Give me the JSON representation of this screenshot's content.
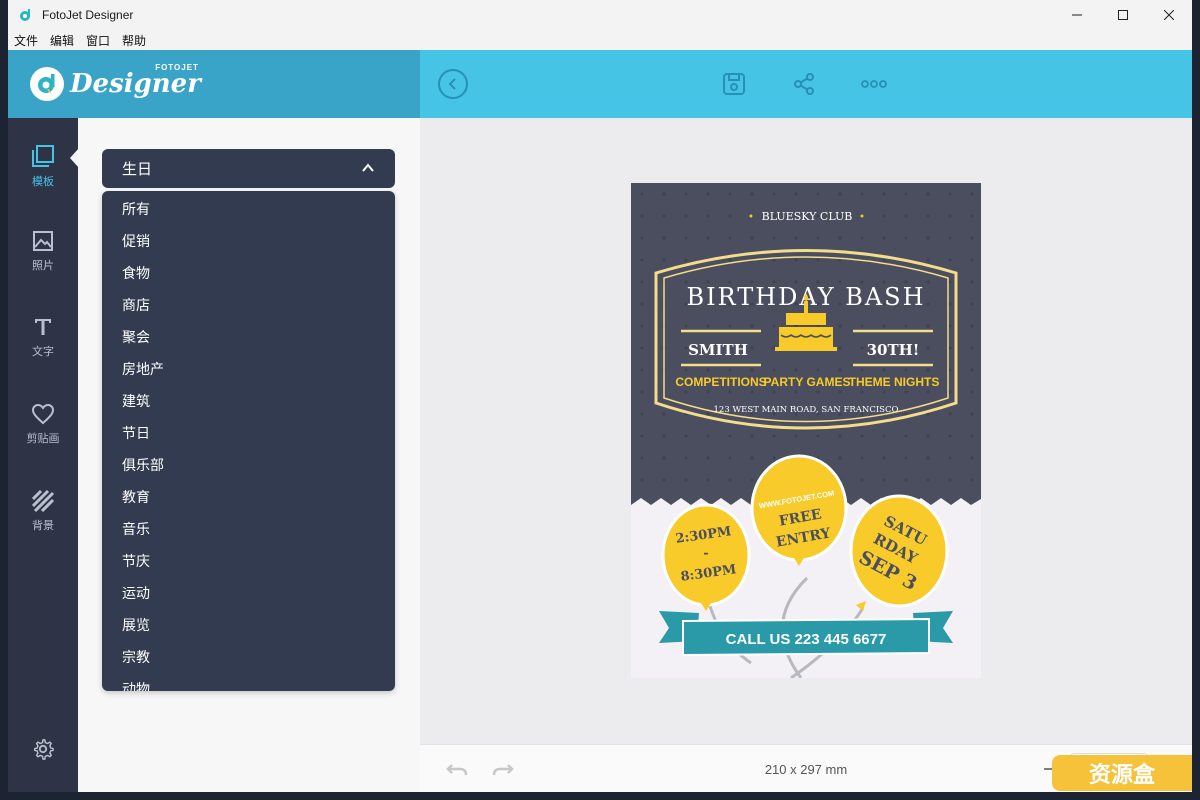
{
  "window": {
    "title": "FotoJet Designer",
    "menu": [
      "文件",
      "编辑",
      "窗口",
      "帮助"
    ]
  },
  "header": {
    "logo_text": "Designer",
    "logo_sub": "FOTOJET"
  },
  "sidebar": {
    "items": [
      {
        "label": "模板",
        "icon": "template-icon",
        "active": true
      },
      {
        "label": "照片",
        "icon": "photo-icon",
        "active": false
      },
      {
        "label": "文字",
        "icon": "text-icon",
        "active": false
      },
      {
        "label": "剪贴画",
        "icon": "heart-icon",
        "active": false
      },
      {
        "label": "背景",
        "icon": "background-icon",
        "active": false
      }
    ],
    "settings_icon": "gear-icon"
  },
  "panel": {
    "category_selected": "生日",
    "category_options": [
      "所有",
      "促销",
      "食物",
      "商店",
      "聚会",
      "房地产",
      "建筑",
      "节日",
      "俱乐部",
      "教育",
      "音乐",
      "节庆",
      "运动",
      "展览",
      "宗教",
      "动物"
    ]
  },
  "poster": {
    "club": "BLUESKY CLUB",
    "title": "BIRTHDAY BASH",
    "name": "SMITH",
    "age": "30TH!",
    "features": [
      "COMPETITIONS",
      "PARTY GAMES",
      "THEME NIGHTS"
    ],
    "address": "123 WEST MAIN ROAD, SAN FRANCISCO",
    "time": [
      "2:30PM",
      "-",
      "8:30PM"
    ],
    "website": "WWW.FOTOJET.COM",
    "entry": [
      "FREE",
      "ENTRY"
    ],
    "date": [
      "SATU",
      "RDAY",
      "SEP 3"
    ],
    "call": "CALL US 223 445 6677",
    "colors": {
      "dark": "#4b4e5e",
      "yellow": "#f8cb2a",
      "cream": "#f3dc8c",
      "teal": "#2b9aa8",
      "light": "#f3f1f5"
    }
  },
  "bottom": {
    "size": "210 x 297 mm",
    "watermark": "资源盒"
  }
}
